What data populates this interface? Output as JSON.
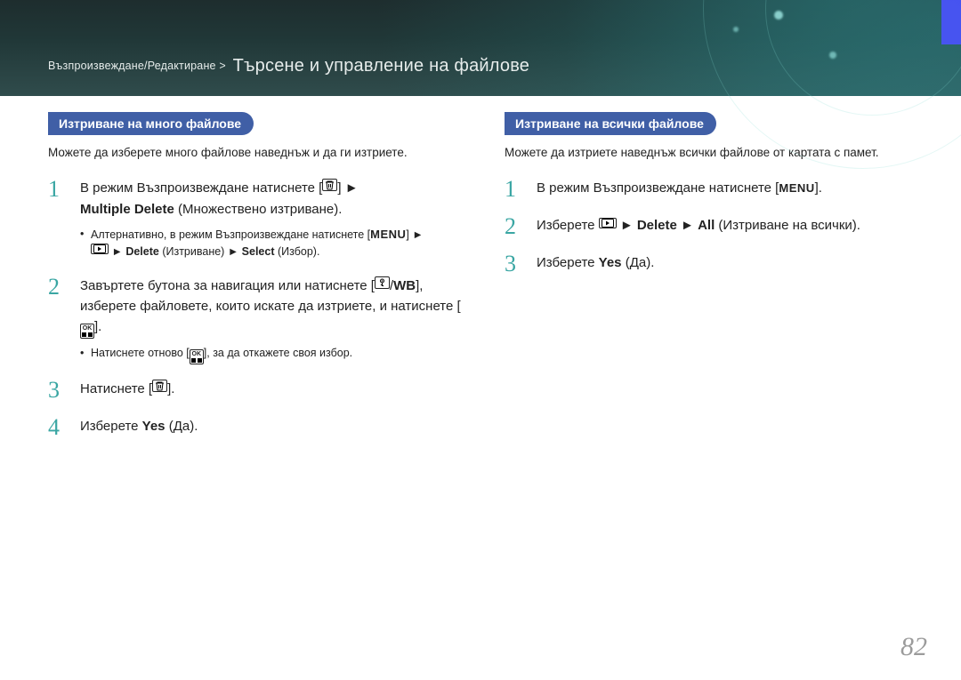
{
  "header": {
    "breadcrumb": "Възпроизвеждане/Редактиране >",
    "title": "Търсене и управление на файлове"
  },
  "left": {
    "heading": "Изтриване на много файлове",
    "intro": "Можете да изберете много файлове наведнъж и да ги изтриете.",
    "s1_a": "В режим Възпроизвеждане натиснете [",
    "s1_b": "] ►",
    "s1_c": "Multiple Delete",
    "s1_d": " (Множествено изтриване).",
    "s1_sub_a": "Алтернативно, в режим Възпроизвеждане натиснете [",
    "s1_sub_b": "] ►",
    "s1_sub_c": " ► ",
    "s1_sub_d": "Delete",
    "s1_sub_e": " (Изтриване) ► ",
    "s1_sub_f": "Select",
    "s1_sub_g": " (Избор).",
    "s2_a": "Завъртете бутона за навигация или натиснете [",
    "s2_b": "/",
    "s2_c": "WB",
    "s2_d": "], изберете файловете, които искате да изтриете, и натиснете [",
    "s2_e": "].",
    "s2_sub_a": "Натиснете отново [",
    "s2_sub_b": "], за да откажете своя избор.",
    "s3_a": "Натиснете [",
    "s3_b": "].",
    "s4_a": "Изберете ",
    "s4_b": "Yes",
    "s4_c": " (Да)."
  },
  "right": {
    "heading": "Изтриване на всички файлове",
    "intro": "Можете да изтриете наведнъж всички файлове от картата с памет.",
    "s1_a": "В режим Възпроизвеждане натиснете [",
    "s1_b": "].",
    "s2_a": "Изберете ",
    "s2_b": " ► ",
    "s2_c": "Delete",
    "s2_d": " ► ",
    "s2_e": "All",
    "s2_f": " (Изтриване на всички).",
    "s3_a": "Изберете ",
    "s3_b": "Yes",
    "s3_c": " (Да)."
  },
  "labels": {
    "menu": "MENU",
    "ok_top": "OK"
  },
  "page": "82",
  "colors": {
    "accent_pill": "#405fa6",
    "step_num": "#3aa6a3"
  }
}
